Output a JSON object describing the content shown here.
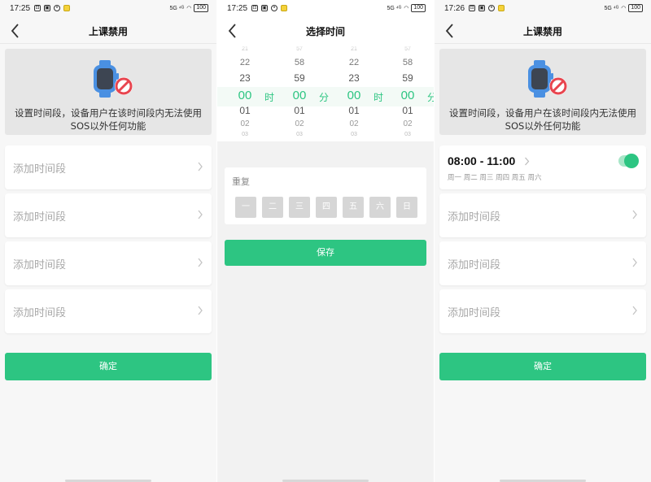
{
  "panel1": {
    "status": {
      "time": "17:25",
      "right": "5G ⁴ᴳ",
      "battery": "100"
    },
    "title": "上课禁用",
    "banner_text": "设置时间段，设备用户在该时间段内无法使用SOS以外任何功能",
    "slots": [
      "添加时间段",
      "添加时间段",
      "添加时间段",
      "添加时间段"
    ],
    "confirm": "确定"
  },
  "panel2": {
    "status": {
      "time": "17:25",
      "right": "5G ⁴ᴳ",
      "battery": "100"
    },
    "title": "选择时间",
    "picker": {
      "start_hour": [
        "21",
        "22",
        "23",
        "00",
        "01",
        "02",
        "03"
      ],
      "start_minute": [
        "57",
        "58",
        "59",
        "00",
        "01",
        "02",
        "03"
      ],
      "end_hour": [
        "21",
        "22",
        "23",
        "00",
        "01",
        "02",
        "03"
      ],
      "end_minute": [
        "57",
        "58",
        "59",
        "00",
        "01",
        "02",
        "03"
      ],
      "hour_unit": "时",
      "minute_unit": "分"
    },
    "repeat_label": "重复",
    "days": [
      "一",
      "二",
      "三",
      "四",
      "五",
      "六",
      "日"
    ],
    "save": "保存"
  },
  "panel3": {
    "status": {
      "time": "17:26",
      "right": "5G ⁴ᴳ",
      "battery": "100"
    },
    "title": "上课禁用",
    "banner_text": "设置时间段，设备用户在该时间段内无法使用SOS以外任何功能",
    "schedule": {
      "time": "08:00 - 11:00",
      "days": "周一 周二 周三 周四 周五 周六",
      "enabled": true
    },
    "slots": [
      "添加时间段",
      "添加时间段",
      "添加时间段"
    ],
    "confirm": "确定"
  },
  "colors": {
    "accent": "#2dc582",
    "banner_bg": "#e6e6e6",
    "day_off": "#d6d6d6"
  }
}
